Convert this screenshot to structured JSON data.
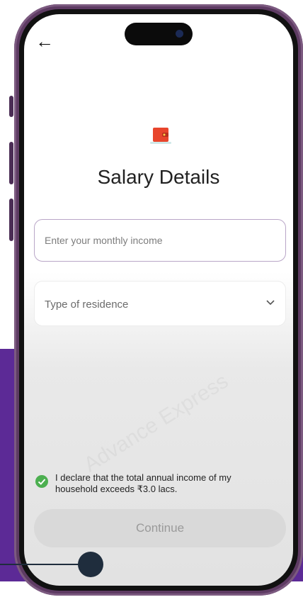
{
  "header": {
    "back_icon": "arrow-left-icon",
    "title": "Salary Details",
    "illustration_icon": "wallet-icon"
  },
  "form": {
    "income_placeholder": "Enter your monthly income",
    "income_value": "",
    "residence_label": "Type of residence",
    "residence_icon": "chevron-down-icon"
  },
  "declaration": {
    "checked": true,
    "text": "I declare that the total annual income of my household exceeds ₹3.0 lacs."
  },
  "actions": {
    "continue_label": "Continue"
  },
  "watermark": "Advance Express",
  "colors": {
    "accent_purple": "#5c2a96",
    "check_green": "#4caf50",
    "wallet_red": "#e8452c"
  }
}
